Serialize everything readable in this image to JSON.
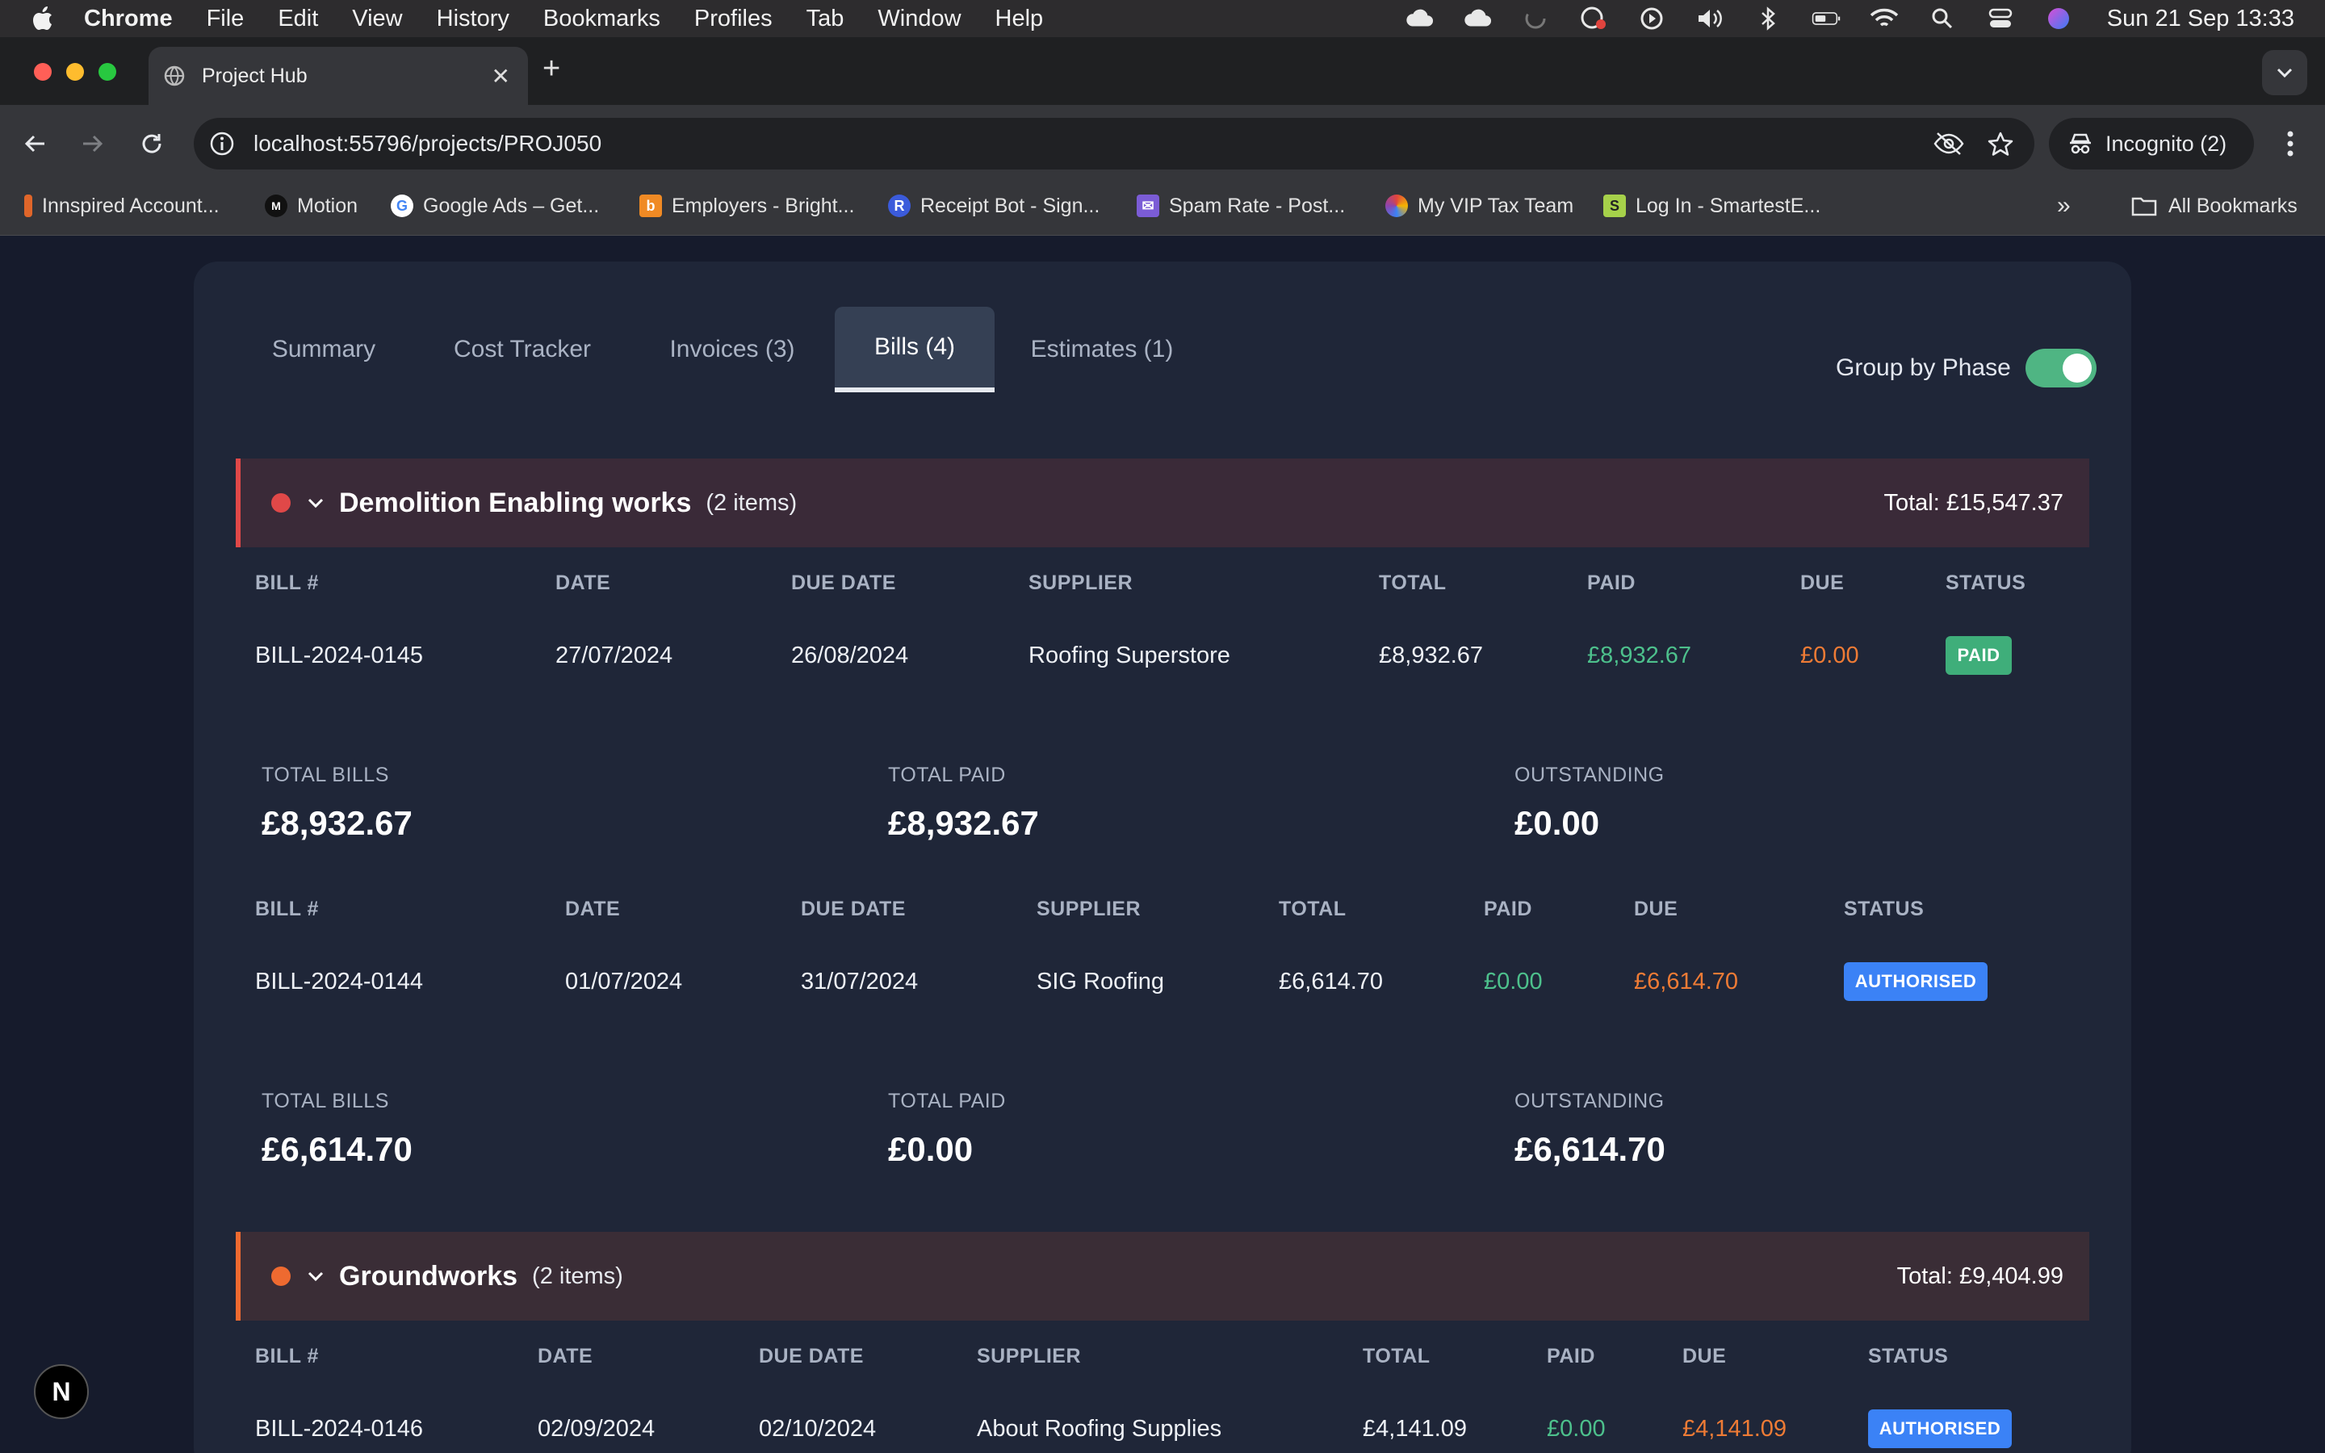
{
  "menubar": {
    "app": "Chrome",
    "items": [
      "File",
      "Edit",
      "View",
      "History",
      "Bookmarks",
      "Profiles",
      "Tab",
      "Window",
      "Help"
    ],
    "clock": "Sun 21 Sep  13:33"
  },
  "browser": {
    "tab_title": "Project Hub",
    "url": "localhost:55796/projects/PROJ050",
    "incognito_label": "Incognito (2)",
    "all_bookmarks": "All Bookmarks",
    "bookmarks": [
      {
        "label": "Innspired Account...",
        "icon_color": "#e0662a"
      },
      {
        "label": "Motion",
        "icon_color": "#111111"
      },
      {
        "label": "Google Ads – Get...",
        "icon_color": "#ffffff"
      },
      {
        "label": "Employers - Bright...",
        "icon_color": "#f08a24"
      },
      {
        "label": "Receipt Bot - Sign...",
        "icon_color": "#3b5bdb"
      },
      {
        "label": "Spam Rate - Post...",
        "icon_color": "#7b5cd6"
      },
      {
        "label": "My VIP Tax Team",
        "icon_color": "#e0443e"
      },
      {
        "label": "Log In - SmartestE...",
        "icon_color": "#a6d14a"
      }
    ]
  },
  "tabs": [
    {
      "label": "Summary",
      "active": false
    },
    {
      "label": "Cost Tracker",
      "active": false
    },
    {
      "label": "Invoices (3)",
      "active": false
    },
    {
      "label": "Bills (4)",
      "active": true
    },
    {
      "label": "Estimates (1)",
      "active": false
    }
  ],
  "group_by_phase": {
    "label": "Group by Phase",
    "on": true
  },
  "columns": [
    "BILL #",
    "DATE",
    "DUE DATE",
    "SUPPLIER",
    "TOTAL",
    "PAID",
    "DUE",
    "STATUS"
  ],
  "summary_labels": {
    "total_bills": "TOTAL BILLS",
    "total_paid": "TOTAL PAID",
    "outstanding": "OUTSTANDING"
  },
  "phases": [
    {
      "name": "Demolition Enabling works",
      "count": "(2 items)",
      "total": "Total: £15,547.37",
      "color": "#e04848",
      "bills": [
        {
          "bill_no": "BILL-2024-0145",
          "date": "27/07/2024",
          "due_date": "26/08/2024",
          "supplier": "Roofing Superstore",
          "total": "£8,932.67",
          "paid": "£8,932.67",
          "due": "£0.00",
          "status": "PAID",
          "status_color": "#3fae7a",
          "summary": {
            "total_bills": "£8,932.67",
            "total_paid": "£8,932.67",
            "outstanding": "£0.00"
          }
        },
        {
          "bill_no": "BILL-2024-0144",
          "date": "01/07/2024",
          "due_date": "31/07/2024",
          "supplier": "SIG Roofing",
          "total": "£6,614.70",
          "paid": "£0.00",
          "due": "£6,614.70",
          "status": "AUTHORISED",
          "status_color": "#3b82f6",
          "summary": {
            "total_bills": "£6,614.70",
            "total_paid": "£0.00",
            "outstanding": "£6,614.70"
          }
        }
      ]
    },
    {
      "name": "Groundworks",
      "count": "(2 items)",
      "total": "Total: £9,404.99",
      "color": "#ee6a30",
      "bills": [
        {
          "bill_no": "BILL-2024-0146",
          "date": "02/09/2024",
          "due_date": "02/10/2024",
          "supplier": "About Roofing Supplies",
          "total": "£4,141.09",
          "paid": "£0.00",
          "due": "£4,141.09",
          "status": "AUTHORISED",
          "status_color": "#3b82f6"
        }
      ]
    }
  ],
  "dev_badge": "N"
}
